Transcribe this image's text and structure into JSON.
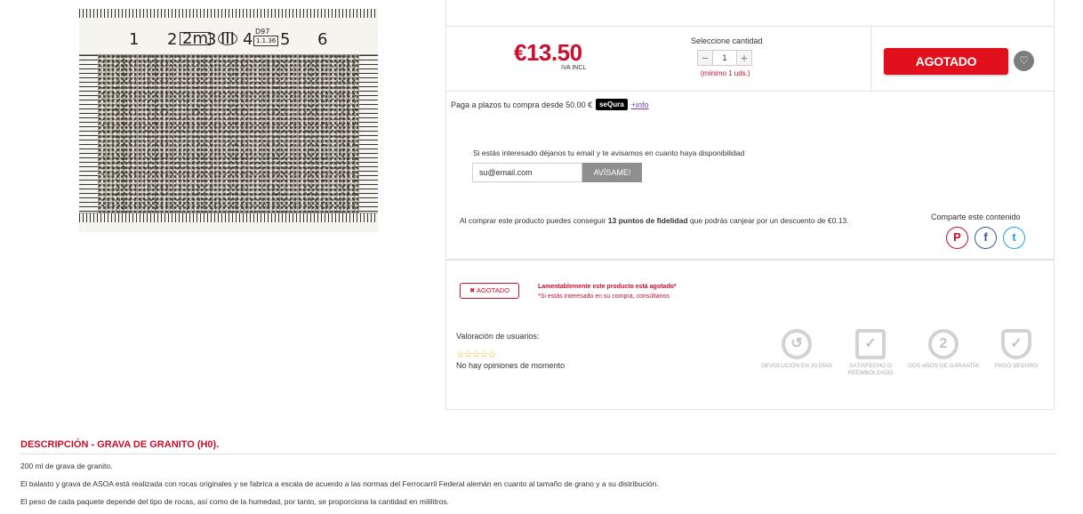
{
  "product_image": {
    "ruler_numbers": [
      "1",
      "2",
      "3",
      "4",
      "5",
      "6"
    ],
    "ruler_marks": [
      "2m",
      "III",
      "D97",
      "1.1.36"
    ]
  },
  "purchase": {
    "price": "€13.50",
    "tax_note": "IVA INCL",
    "qty_label": "Seleccione cantidad",
    "qty_minus": "−",
    "qty_value": "1",
    "qty_plus": "+",
    "qty_min": "(mínimo 1 uds.)",
    "add_button": "AGOTADO",
    "wishlist_icon": "heart-icon"
  },
  "installments": {
    "text": "Paga a plazos tu compra desde 50.00 €",
    "badge": "seQura",
    "link": "+info"
  },
  "notify": {
    "text": "Si estás interesado déjanos tu email y te avisamos en cuanto haya disponibilidad",
    "placeholder": "su@email.com",
    "button": "AVÍSAME!"
  },
  "fidelity": {
    "prefix": "Al comprar este producto puedes conseguir ",
    "points": "13 puntos de fidelidad",
    "suffix": " que podrás canjear por un descuento de €0.13."
  },
  "share": {
    "label": "Comparte este contenido",
    "icons": [
      "pinterest-icon",
      "facebook-icon",
      "twitter-icon"
    ]
  },
  "stock": {
    "badge": "AGOTADO",
    "message": "Lamentablemente este producto está agotado*",
    "note": "*Si estás interesado en su compra, consúltanos"
  },
  "reviews": {
    "label": "Valoración de usuarios:",
    "stars": "☆☆☆☆☆",
    "empty": "No hay opiniones de momento"
  },
  "trust": [
    {
      "label": "DEVOLUCIÓN EN 30 DÍAS",
      "icon": "return-icon"
    },
    {
      "label": "SATISFECHO O REEMBOLSADO",
      "icon": "refund-icon"
    },
    {
      "label": "DOS AÑOS DE GARANTÍA",
      "icon": "warranty-icon"
    },
    {
      "label": "PAGO SEGURO",
      "icon": "secure-payment-icon"
    }
  ],
  "description": {
    "title": "DESCRIPCIÓN - GRAVA DE GRANITO (H0).",
    "paragraphs": [
      "200 ml de grava de granito.",
      "El balasto y grava de ASOA está realizada con rocas originales y se fabrica a escala de acuerdo a las normas del Ferrocarril Federal alemán en cuanto al tamaño de grano y a su distribución.",
      "El peso de cada paquete depende del tipo de rocas, así como de la humedad, por tanto, se proporciona la cantidad en mililitros."
    ]
  },
  "colors": {
    "accent": "#c8102e",
    "button": "#e0101c"
  }
}
